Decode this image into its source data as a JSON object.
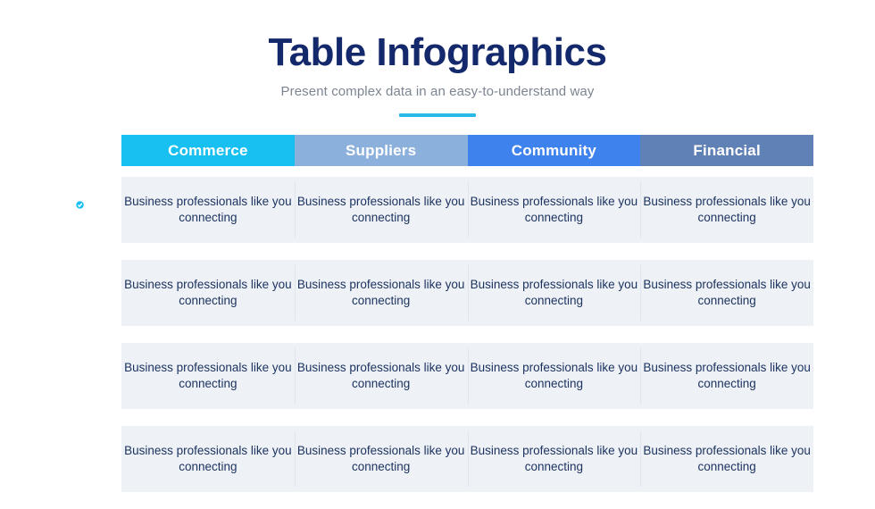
{
  "header": {
    "title": "Table Infographics",
    "subtitle": "Present complex data in an easy-to-understand way"
  },
  "colors": {
    "title": "#14296b",
    "subtitle": "#7c8591",
    "accent_rule": "#29b8e8",
    "row_background": "#eef1f6",
    "cell_text": "#1d3461",
    "page_background": "#ffffff"
  },
  "table": {
    "columns": [
      {
        "label": "Commerce",
        "color": "#17c0f0"
      },
      {
        "label": "Suppliers",
        "color": "#8cb0dc"
      },
      {
        "label": "Community",
        "color": "#3e82ee"
      },
      {
        "label": "Financial",
        "color": "#6081b5"
      }
    ],
    "rows": [
      {
        "icon": "credit-card-check-icon",
        "icon_color": "#17c0f0",
        "cells": [
          "Business professionals like you connecting",
          "Business professionals like you connecting",
          "Business professionals like you connecting",
          "Business professionals like you connecting"
        ]
      },
      {
        "icon": "two-idea-bulbs-icon",
        "icon_color": "#8cb0dc",
        "cells": [
          "Business professionals like you connecting",
          "Business professionals like you connecting",
          "Business professionals like you connecting",
          "Business professionals like you connecting"
        ]
      },
      {
        "icon": "coffee-cup-clock-icon",
        "icon_color": "#3e82ee",
        "cells": [
          "Business professionals like you connecting",
          "Business professionals like you connecting",
          "Business professionals like you connecting",
          "Business professionals like you connecting"
        ]
      },
      {
        "icon": "person-growth-arrows-icon",
        "icon_color": "#6081b5",
        "cells": [
          "Business professionals like you connecting",
          "Business professionals like you connecting",
          "Business professionals like you connecting",
          "Business professionals like you connecting"
        ]
      }
    ]
  }
}
